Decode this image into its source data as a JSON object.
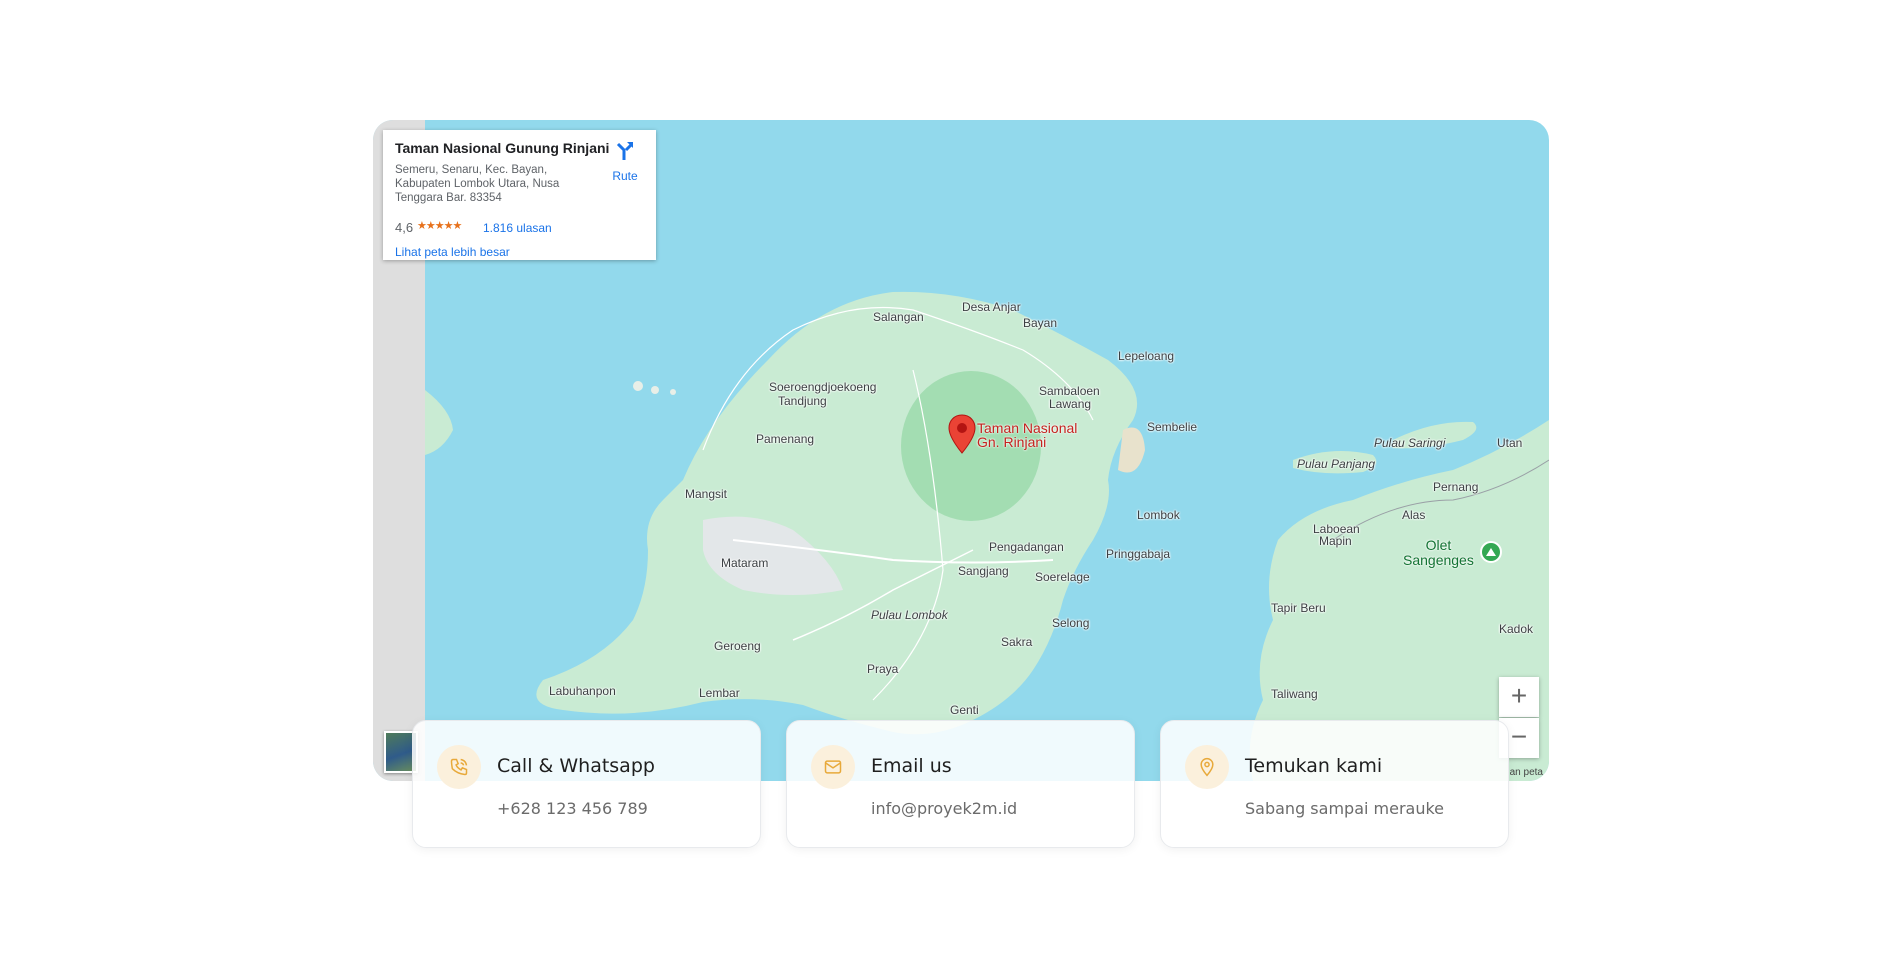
{
  "place_card": {
    "name": "Taman Nasional Gunung Rinjani",
    "address": "Semeru, Senaru, Kec. Bayan, Kabupaten Lombok Utara, Nusa Tenggara Bar. 83354",
    "rating": "4,6",
    "stars": "★★★★★",
    "reviews": "1.816 ulasan",
    "larger_map_link": "Lihat peta lebih besar",
    "route_label": "Rute"
  },
  "map": {
    "marker_label_line1": "Taman Nasional",
    "marker_label_line2": "Gn. Rinjani",
    "park_label_line1": "Olet",
    "park_label_line2": "Sangenges",
    "places": {
      "salangan": "Salangan",
      "desa_anjar": "Desa Anjar",
      "bayan": "Bayan",
      "lepeloang": "Lepeloang",
      "soeroengdjoekoeng": "Soeroengdjoekoeng",
      "tandjung": "Tandjung",
      "sambaloen": "Sambaloen",
      "lawang": "Lawang",
      "sembelie": "Sembelie",
      "pamenang": "Pamenang",
      "mangsit": "Mangsit",
      "lombok": "Lombok",
      "pengadangan": "Pengadangan",
      "pringgabaja": "Pringgabaja",
      "mataram": "Mataram",
      "sangjang": "Sangjang",
      "soerelage": "Soerelage",
      "pulau_lombok": "Pulau Lombok",
      "selong": "Selong",
      "geroeng": "Geroeng",
      "sakra": "Sakra",
      "praya": "Praya",
      "labuhanpon": "Labuhanpon",
      "lembar": "Lembar",
      "genti": "Genti",
      "pulau_saringi": "Pulau Saringi",
      "utan": "Utan",
      "pulau_panjang": "Pulau Panjang",
      "pernang": "Pernang",
      "laboean_line1": "Laboean",
      "laboean_line2": "Mapin",
      "alas": "Alas",
      "tapir_beru": "Tapir Beru",
      "kadok": "Kadok",
      "taliwang": "Taliwang"
    },
    "zoom_in": "+",
    "zoom_out": "−",
    "credit": "an peta"
  },
  "contacts": [
    {
      "title": "Call & Whatsapp",
      "text": "+628 123 456 789",
      "icon": "phone-icon"
    },
    {
      "title": "Email us",
      "text": "info@proyek2m.id",
      "icon": "mail-icon"
    },
    {
      "title": "Temukan kami",
      "text": "Sabang sampai merauke",
      "icon": "location-pin-icon"
    }
  ],
  "colors": {
    "water": "#92d9ec",
    "land": "#c9ebd3",
    "park": "#9fdcae",
    "accent_icon": "#e8a93a",
    "link": "#1a73e8",
    "marker": "#ea4335"
  }
}
